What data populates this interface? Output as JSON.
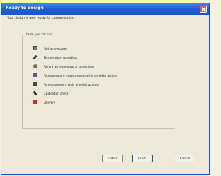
{
  "window": {
    "title": "Ready to design"
  },
  "intro_text": "Your design is now ready for customisation.",
  "group_label": "Items you can add",
  "options": [
    {
      "label": "Add a new page",
      "icon": "page-icon"
    },
    {
      "label": "Temperature recording",
      "icon": "thermometer-icon"
    },
    {
      "label": "Record an inspection of something",
      "icon": "eye-icon"
    },
    {
      "label": "A temperature measurement with remedial actions",
      "icon": "temperature-remedial-icon"
    },
    {
      "label": "A measurement with remedial actions",
      "icon": "measurement-icon"
    },
    {
      "label": "Calibration check",
      "icon": "calibration-icon"
    },
    {
      "label": "Delivery",
      "icon": "delivery-icon"
    }
  ],
  "buttons": {
    "back": "< Back",
    "finish": "Finish",
    "cancel": "Cancel"
  },
  "colors": {
    "titlebar": "#1f5fd6",
    "dialog_bg": "#ece9d8",
    "background_strip": "#fbf7b6"
  }
}
